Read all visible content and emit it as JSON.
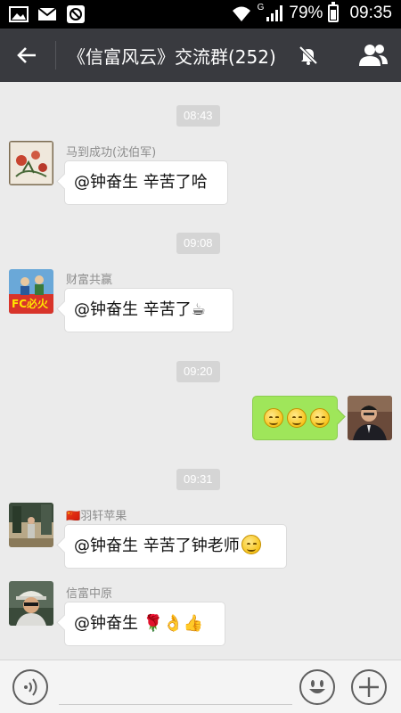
{
  "statusbar": {
    "network": "G",
    "battery_percent": "79%",
    "battery_level": 0.79,
    "time": "09:35",
    "icons": [
      "image-icon",
      "mail-icon",
      "blocked-icon",
      "wifi-icon",
      "signal-icon",
      "battery-icon"
    ]
  },
  "titlebar": {
    "title": "《信富风云》交流群(252)",
    "back_icon": "back-arrow-icon",
    "mute_icon": "bell-muted-icon",
    "members_icon": "group-members-icon"
  },
  "messages": [
    {
      "time": "08:43",
      "sender": "马到成功(沈伯军)",
      "text": "@钟奋生 辛苦了哈",
      "side": "left",
      "avatar": "painting-avatar"
    },
    {
      "time": "09:08",
      "sender": "财富共赢",
      "text": "@钟奋生 辛苦了",
      "emoji": "☕",
      "side": "left",
      "avatar": "group-photo-avatar"
    },
    {
      "time": "09:20",
      "sender": "",
      "emoji_count": 3,
      "side": "right",
      "avatar": "self-avatar"
    },
    {
      "time": "09:31",
      "sender": "羽轩苹果",
      "sender_flag": "🇨🇳",
      "text": "@钟奋生 辛苦了钟老师",
      "side": "left",
      "avatar": "outdoor-avatar"
    },
    {
      "time": "",
      "sender": "信富中原",
      "text": "@钟奋生",
      "emoji": "🌹👌👍",
      "side": "left",
      "avatar": "man-hat-avatar"
    }
  ],
  "inputbar": {
    "placeholder": "",
    "voice_icon": "voice-icon",
    "emoji_icon": "emoji-icon",
    "plus_icon": "plus-icon"
  }
}
